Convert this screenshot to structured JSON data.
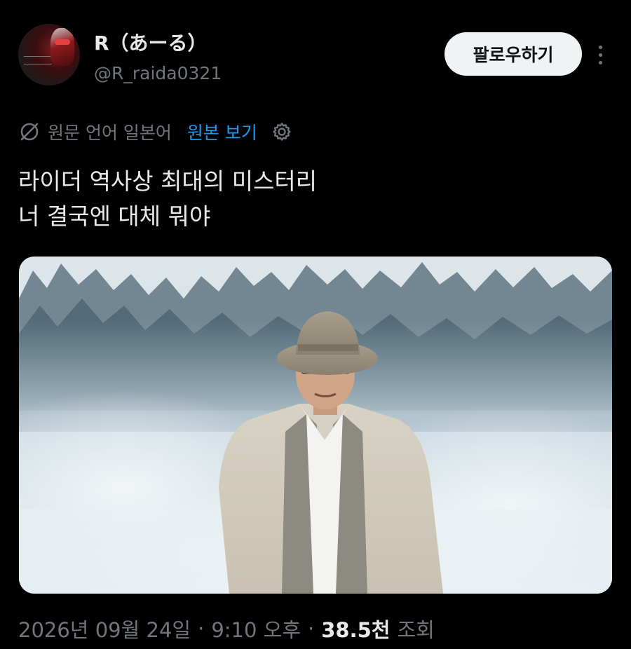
{
  "user": {
    "display_name": "R（あーる）",
    "handle": "@R_raida0321"
  },
  "header": {
    "follow_label": "팔로우하기"
  },
  "translation": {
    "source_text": "원문 언어 일본어",
    "show_original_label": "원본 보기",
    "icon": "translate-off-icon",
    "settings_icon": "gear-icon"
  },
  "tweet": {
    "lines": [
      "라이더 역사상 최대의 미스터리",
      "너 결국엔 대체 뭐야"
    ]
  },
  "meta": {
    "date": "2026년 09월 24일",
    "separator1": "·",
    "time": "9:10 오후",
    "separator2": "·",
    "views_count": "38.5천",
    "views_label": "조회"
  },
  "colors": {
    "background": "#000000",
    "text_primary": "#e7e9ea",
    "text_secondary": "#71767b",
    "link": "#1d9bf0",
    "follow_button_bg": "#eff3f4"
  }
}
